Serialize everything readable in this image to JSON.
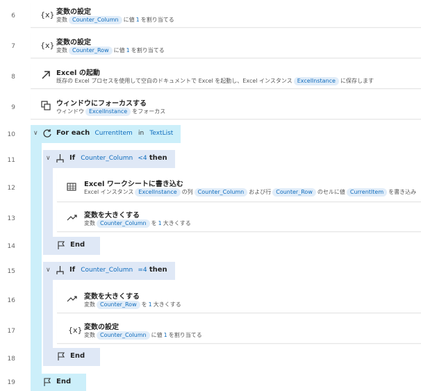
{
  "line_numbers": [
    "6",
    "7",
    "8",
    "9",
    "10",
    "11",
    "12",
    "13",
    "14",
    "15",
    "16",
    "17",
    "18",
    "19"
  ],
  "steps": {
    "s6": {
      "icon_text": "{x}",
      "title": "変数の設定",
      "d1": "変数",
      "var": "Counter_Column",
      "d2": "に値",
      "val": "1",
      "d3": "を割り当てる"
    },
    "s7": {
      "icon_text": "{x}",
      "title": "変数の設定",
      "d1": "変数",
      "var": "Counter_Row",
      "d2": "に値",
      "val": "1",
      "d3": "を割り当てる"
    },
    "s8": {
      "title": "Excel の起動",
      "d1": "既存の Excel プロセスを使用して空白のドキュメントで Excel を起動し、Excel インスタンス",
      "var": "ExcelInstance",
      "d2": "に保存します"
    },
    "s9": {
      "title": "ウィンドウにフォーカスする",
      "d1": "ウィンドウ",
      "var": "ExcelInstance",
      "d2": "をフォーカス"
    },
    "s10": {
      "kw1": "For each",
      "var1": "CurrentItem",
      "kw2": "in",
      "var2": "TextList"
    },
    "s11": {
      "kw1": "If",
      "var1": "Counter_Column",
      "op": "<4",
      "kw2": "then"
    },
    "s12": {
      "title": "Excel ワークシートに書き込む",
      "d1": "Excel インスタンス",
      "var1": "ExcelInstance",
      "d2": "の列",
      "var2": "Counter_Column",
      "d3": "および行",
      "var3": "Counter_Row",
      "d4": "のセルに値",
      "var4": "CurrentItem",
      "d5": "を書き込み"
    },
    "s13": {
      "title": "変数を大きくする",
      "d1": "変数",
      "var": "Counter_Column",
      "d2": "を",
      "val": "1",
      "d3": "大きくする"
    },
    "s14": {
      "kw": "End"
    },
    "s15": {
      "kw1": "If",
      "var1": "Counter_Column",
      "op": "=4",
      "kw2": "then"
    },
    "s16": {
      "title": "変数を大きくする",
      "d1": "変数",
      "var": "Counter_Row",
      "d2": "を",
      "val": "1",
      "d3": "大きくする"
    },
    "s17": {
      "icon_text": "{x}",
      "title": "変数の設定",
      "d1": "変数",
      "var": "Counter_Column",
      "d2": "に値",
      "val": "1",
      "d3": "を割り当てる"
    },
    "s18": {
      "kw": "End"
    },
    "s19": {
      "kw": "End"
    }
  },
  "colors": {
    "accent": "#0f6cbd",
    "token_bg": "#e1edf9",
    "foreach_bg": "#cceffa",
    "if_bg": "#dfe8f6"
  }
}
